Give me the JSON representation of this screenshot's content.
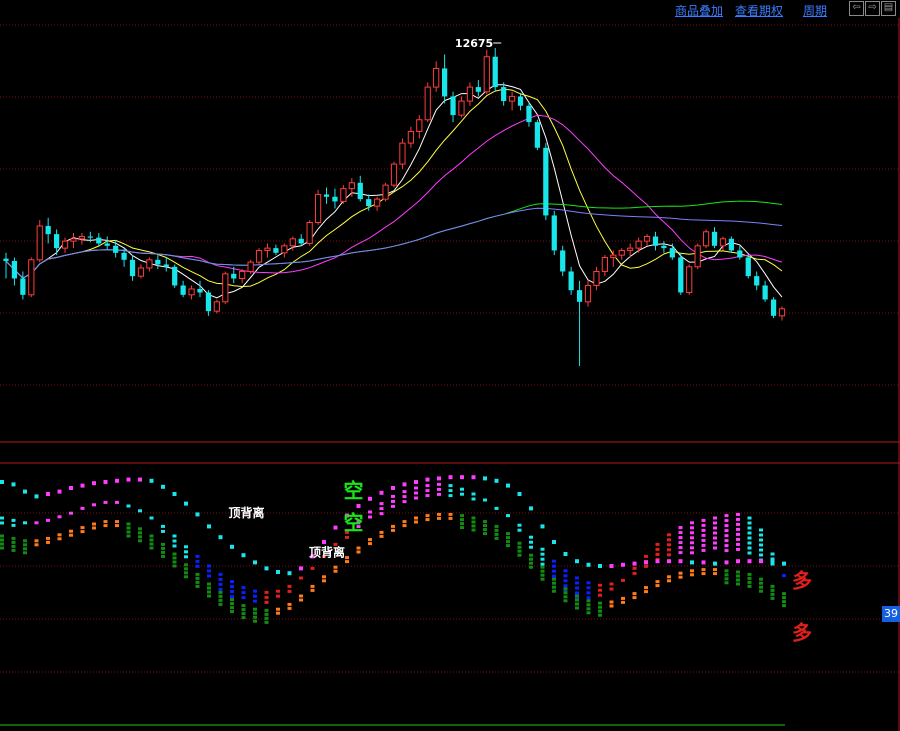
{
  "toolbar": {
    "overlay_label": "商品叠加",
    "options_label": "查看期权",
    "period_label": "周期",
    "nav_icons": [
      "left-arrow-icon",
      "right-arrow-icon",
      "window-icon"
    ]
  },
  "current_value_badge": "39",
  "chart_data": [
    {
      "type": "candlestick",
      "annotations": [
        {
          "text": "12675",
          "arrow": "right"
        }
      ],
      "grid": "horizontal dotted red lines",
      "colors": {
        "up": "#ff3c3c",
        "down": "#19e6ea",
        "ma5": "#ffffff",
        "ma10": "#ffff40",
        "ma20": "#ff3cff",
        "ma60": "#19e619",
        "ma120": "#7f7fff"
      },
      "ohlc": [
        [
          10870,
          10920,
          10700,
          10850
        ],
        [
          10850,
          10880,
          10640,
          10700
        ],
        [
          10700,
          10760,
          10520,
          10560
        ],
        [
          10560,
          10880,
          10540,
          10860
        ],
        [
          10860,
          11200,
          10840,
          11150
        ],
        [
          11150,
          11220,
          11000,
          11080
        ],
        [
          11080,
          11120,
          10900,
          10960
        ],
        [
          10960,
          11050,
          10920,
          11020
        ],
        [
          11020,
          11090,
          10960,
          11040
        ],
        [
          11040,
          11090,
          10990,
          11060
        ],
        [
          11060,
          11100,
          11010,
          11050
        ],
        [
          11050,
          11090,
          10980,
          11000
        ],
        [
          11000,
          11060,
          10950,
          10980
        ],
        [
          10980,
          11030,
          10880,
          10920
        ],
        [
          10920,
          10960,
          10800,
          10860
        ],
        [
          10860,
          10900,
          10680,
          10720
        ],
        [
          10720,
          10820,
          10700,
          10790
        ],
        [
          10790,
          10880,
          10760,
          10860
        ],
        [
          10860,
          10900,
          10780,
          10820
        ],
        [
          10820,
          10880,
          10760,
          10800
        ],
        [
          10800,
          10820,
          10620,
          10640
        ],
        [
          10640,
          10680,
          10540,
          10560
        ],
        [
          10560,
          10640,
          10520,
          10610
        ],
        [
          10610,
          10680,
          10540,
          10580
        ],
        [
          10580,
          10600,
          10380,
          10420
        ],
        [
          10420,
          10520,
          10400,
          10500
        ],
        [
          10500,
          10760,
          10480,
          10740
        ],
        [
          10740,
          10800,
          10660,
          10700
        ],
        [
          10700,
          10780,
          10660,
          10760
        ],
        [
          10760,
          10860,
          10740,
          10840
        ],
        [
          10840,
          10960,
          10820,
          10940
        ],
        [
          10940,
          11000,
          10880,
          10960
        ],
        [
          10960,
          10990,
          10900,
          10920
        ],
        [
          10920,
          11000,
          10880,
          10980
        ],
        [
          10980,
          11060,
          10940,
          11040
        ],
        [
          11040,
          11080,
          10980,
          11000
        ],
        [
          11000,
          11200,
          10980,
          11180
        ],
        [
          11180,
          11460,
          11160,
          11420
        ],
        [
          11420,
          11480,
          11340,
          11400
        ],
        [
          11400,
          11470,
          11300,
          11360
        ],
        [
          11360,
          11500,
          11340,
          11470
        ],
        [
          11470,
          11560,
          11400,
          11520
        ],
        [
          11520,
          11580,
          11360,
          11380
        ],
        [
          11380,
          11420,
          11280,
          11320
        ],
        [
          11320,
          11400,
          11280,
          11380
        ],
        [
          11380,
          11520,
          11360,
          11500
        ],
        [
          11500,
          11700,
          11480,
          11680
        ],
        [
          11680,
          11900,
          11640,
          11860
        ],
        [
          11860,
          12000,
          11820,
          11960
        ],
        [
          11960,
          12100,
          11900,
          12060
        ],
        [
          12060,
          12380,
          12040,
          12340
        ],
        [
          12340,
          12560,
          12300,
          12500
        ],
        [
          12500,
          12620,
          12200,
          12260
        ],
        [
          12260,
          12300,
          12040,
          12100
        ],
        [
          12100,
          12260,
          12080,
          12220
        ],
        [
          12220,
          12380,
          12180,
          12340
        ],
        [
          12340,
          12400,
          12260,
          12300
        ],
        [
          12300,
          12660,
          12280,
          12600
        ],
        [
          12600,
          12675,
          12300,
          12340
        ],
        [
          12340,
          12380,
          12180,
          12220
        ],
        [
          12220,
          12300,
          12140,
          12260
        ],
        [
          12260,
          12290,
          12140,
          12180
        ],
        [
          12180,
          12200,
          12000,
          12040
        ],
        [
          12040,
          12060,
          11800,
          11820
        ],
        [
          11820,
          11860,
          11200,
          11240
        ],
        [
          11240,
          11280,
          10900,
          10940
        ],
        [
          10940,
          10980,
          10720,
          10760
        ],
        [
          10760,
          10800,
          10560,
          10600
        ],
        [
          10600,
          10680,
          9950,
          10500
        ],
        [
          10500,
          10680,
          10460,
          10640
        ],
        [
          10640,
          10800,
          10600,
          10760
        ],
        [
          10760,
          10900,
          10720,
          10880
        ],
        [
          10880,
          10940,
          10800,
          10900
        ],
        [
          10900,
          10960,
          10860,
          10940
        ],
        [
          10940,
          11000,
          10880,
          10960
        ],
        [
          10960,
          11050,
          10920,
          11020
        ],
        [
          11020,
          11080,
          10980,
          11060
        ],
        [
          11060,
          11100,
          10940,
          10980
        ],
        [
          10980,
          11020,
          10920,
          10960
        ],
        [
          10960,
          11000,
          10860,
          10880
        ],
        [
          10880,
          10920,
          10560,
          10580
        ],
        [
          10580,
          10820,
          10560,
          10800
        ],
        [
          10800,
          11000,
          10780,
          10980
        ],
        [
          10980,
          11120,
          10960,
          11100
        ],
        [
          11100,
          11140,
          10960,
          10980
        ],
        [
          10980,
          11060,
          10940,
          11040
        ],
        [
          11040,
          11060,
          10920,
          10940
        ],
        [
          10940,
          10980,
          10860,
          10880
        ],
        [
          10880,
          10900,
          10700,
          10720
        ],
        [
          10720,
          10760,
          10600,
          10640
        ],
        [
          10640,
          10680,
          10500,
          10520
        ],
        [
          10520,
          10540,
          10360,
          10380
        ],
        [
          10380,
          10460,
          10340,
          10440
        ]
      ],
      "moving_averages": [
        "MA5",
        "MA10",
        "MA20",
        "MA60",
        "MA120"
      ]
    },
    {
      "type": "indicator",
      "annotations": [
        "顶背离",
        "顶背离",
        "空",
        "空",
        "多",
        "多"
      ],
      "series": [
        {
          "values": [
            0.7,
            0.68,
            0.62,
            0.58,
            0.6,
            0.62,
            0.65,
            0.67,
            0.69,
            0.7,
            0.71,
            0.72,
            0.72,
            0.71,
            0.66,
            0.6,
            0.52,
            0.43,
            0.33,
            0.24,
            0.16,
            0.09,
            0.03,
            -0.02,
            -0.05,
            -0.06,
            -0.02,
            0.08,
            0.2,
            0.32,
            0.42,
            0.5,
            0.56,
            0.61,
            0.65,
            0.68,
            0.7,
            0.72,
            0.73,
            0.74,
            0.74,
            0.74,
            0.73,
            0.71,
            0.67,
            0.6,
            0.48,
            0.33,
            0.2,
            0.1,
            0.04,
            0.01,
            0.0,
            0.0,
            0.01,
            0.02,
            0.03,
            0.04,
            0.04,
            0.04,
            0.03,
            0.03,
            0.02,
            0.03,
            0.04,
            0.04,
            0.04,
            0.03,
            0.02
          ]
        },
        {
          "values": [
            0.35,
            0.33,
            0.32,
            0.33,
            0.36,
            0.4,
            0.44,
            0.48,
            0.51,
            0.53,
            0.53,
            0.5,
            0.44,
            0.36,
            0.26,
            0.16,
            0.06,
            -0.04,
            -0.12,
            -0.2,
            -0.26,
            -0.3,
            -0.32,
            -0.32,
            -0.29,
            -0.22,
            -0.12,
            -0.02,
            0.08,
            0.18,
            0.28,
            0.37,
            0.45,
            0.52,
            0.58,
            0.62,
            0.65,
            0.67,
            0.68,
            0.67,
            0.64,
            0.6,
            0.55,
            0.48,
            0.4,
            0.28,
            0.14,
            0.0,
            -0.12,
            -0.22,
            -0.28,
            -0.3,
            -0.28,
            -0.22,
            -0.12,
            -0.02,
            0.08,
            0.18,
            0.26,
            0.32,
            0.36,
            0.38,
            0.4,
            0.42,
            0.43,
            0.4,
            0.3,
            0.1,
            -0.1
          ]
        },
        {
          "values": [
            0.4,
            0.38,
            0.36,
            0.36,
            0.38,
            0.41,
            0.44,
            0.47,
            0.5,
            0.52,
            0.52,
            0.5,
            0.46,
            0.4,
            0.33,
            0.25,
            0.16,
            0.08,
            0.0,
            -0.07,
            -0.13,
            -0.18,
            -0.21,
            -0.22,
            -0.21,
            -0.17,
            -0.1,
            -0.02,
            0.06,
            0.14,
            0.22,
            0.3,
            0.37,
            0.43,
            0.48,
            0.52,
            0.55,
            0.57,
            0.58,
            0.58,
            0.57,
            0.55,
            0.52,
            0.48,
            0.42,
            0.34,
            0.24,
            0.14,
            0.04,
            -0.04,
            -0.1,
            -0.14,
            -0.16,
            -0.15,
            -0.12,
            -0.08,
            -0.03,
            0.02,
            0.06,
            0.09,
            0.11,
            0.12,
            0.12,
            0.11,
            0.1,
            0.08,
            0.04,
            -0.02,
            -0.08
          ]
        }
      ]
    }
  ]
}
